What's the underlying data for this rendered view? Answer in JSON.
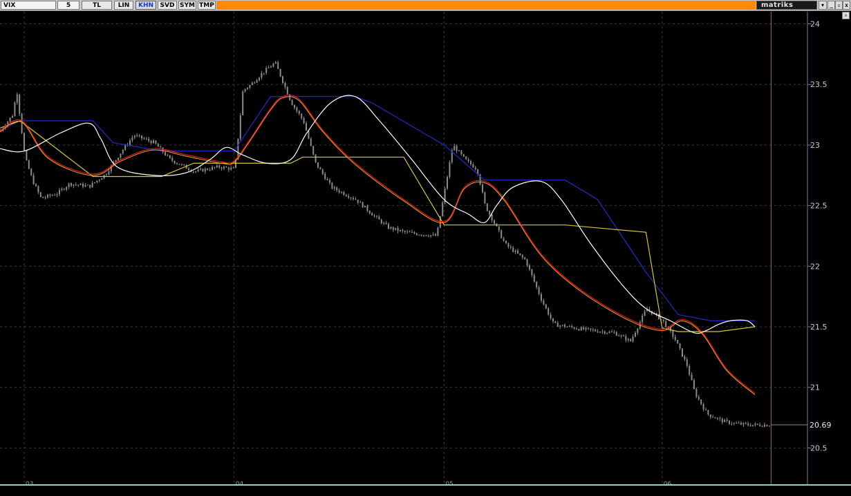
{
  "toolbar": {
    "symbol": "VIX",
    "period": "5",
    "buttons": [
      {
        "id": "tl",
        "label": "TL"
      },
      {
        "id": "lin",
        "label": "LIN"
      },
      {
        "id": "khn",
        "label": "KHN",
        "active": true
      },
      {
        "id": "svd",
        "label": "SVD"
      },
      {
        "id": "sym",
        "label": "SYM"
      },
      {
        "id": "tmp",
        "label": "TMP"
      }
    ],
    "brand": "matriks",
    "dropdown_glyph": "▾",
    "window_controls": [
      "_",
      "▫",
      "x"
    ],
    "accent_color": "#ff8a00"
  },
  "chart_data": {
    "type": "candlestick",
    "symbol": "VIX",
    "interval": "5",
    "ylim": [
      20.2,
      24.1
    ],
    "yticks": [
      24,
      23.5,
      23,
      22.5,
      22,
      21.5,
      21,
      20.5
    ],
    "last_value": 20.69,
    "x_day_labels": [
      "03",
      "04",
      "05",
      "06"
    ],
    "x_day_positions": [
      0.03,
      0.29,
      0.55,
      0.82
    ],
    "cursor_position": 0.955,
    "colors": {
      "candles": "#8c8c8c",
      "blue_line": "#1e2ccc",
      "red_line": "#e01e1e",
      "yellow_line": "#d8c830",
      "white_line": "#ffffff",
      "cursor": "#a040a0",
      "grid": "#3a3a3a",
      "axis": "#7a7aa0"
    },
    "series": [
      {
        "kind": "step",
        "color": "blue",
        "points": [
          [
            0.0,
            23.12
          ],
          [
            0.025,
            23.2
          ],
          [
            0.115,
            23.2
          ],
          [
            0.14,
            23.02
          ],
          [
            0.2,
            22.95
          ],
          [
            0.25,
            22.95
          ],
          [
            0.28,
            22.95
          ],
          [
            0.29,
            22.95
          ],
          [
            0.335,
            23.4
          ],
          [
            0.44,
            23.4
          ],
          [
            0.46,
            23.35
          ],
          [
            0.55,
            23.0
          ],
          [
            0.6,
            22.71
          ],
          [
            0.7,
            22.71
          ],
          [
            0.74,
            22.55
          ],
          [
            0.8,
            21.95
          ],
          [
            0.84,
            21.6
          ],
          [
            0.88,
            21.55
          ],
          [
            0.935,
            21.55
          ]
        ]
      },
      {
        "kind": "step",
        "color": "yellow",
        "points": [
          [
            0.0,
            23.14
          ],
          [
            0.025,
            23.2
          ],
          [
            0.115,
            22.74
          ],
          [
            0.2,
            22.74
          ],
          [
            0.24,
            22.85
          ],
          [
            0.29,
            22.85
          ],
          [
            0.335,
            22.85
          ],
          [
            0.36,
            22.85
          ],
          [
            0.375,
            22.9
          ],
          [
            0.4,
            22.9
          ],
          [
            0.44,
            22.9
          ],
          [
            0.5,
            22.9
          ],
          [
            0.55,
            22.34
          ],
          [
            0.64,
            22.34
          ],
          [
            0.7,
            22.34
          ],
          [
            0.8,
            22.28
          ],
          [
            0.82,
            21.49
          ],
          [
            0.84,
            21.46
          ],
          [
            0.89,
            21.46
          ],
          [
            0.935,
            21.5
          ]
        ]
      },
      {
        "kind": "smooth",
        "color": "red",
        "points": [
          [
            0.0,
            23.12
          ],
          [
            0.027,
            23.2
          ],
          [
            0.06,
            22.9
          ],
          [
            0.115,
            22.76
          ],
          [
            0.15,
            22.88
          ],
          [
            0.19,
            22.97
          ],
          [
            0.23,
            22.92
          ],
          [
            0.275,
            22.86
          ],
          [
            0.29,
            22.87
          ],
          [
            0.31,
            23.05
          ],
          [
            0.335,
            23.3
          ],
          [
            0.35,
            23.4
          ],
          [
            0.37,
            23.38
          ],
          [
            0.4,
            23.12
          ],
          [
            0.44,
            22.85
          ],
          [
            0.5,
            22.55
          ],
          [
            0.55,
            22.37
          ],
          [
            0.575,
            22.65
          ],
          [
            0.6,
            22.7
          ],
          [
            0.625,
            22.55
          ],
          [
            0.67,
            22.1
          ],
          [
            0.72,
            21.8
          ],
          [
            0.78,
            21.56
          ],
          [
            0.82,
            21.48
          ],
          [
            0.845,
            21.56
          ],
          [
            0.87,
            21.45
          ],
          [
            0.9,
            21.15
          ],
          [
            0.935,
            20.95
          ]
        ]
      },
      {
        "kind": "smooth",
        "color": "white",
        "points": [
          [
            0.0,
            22.97
          ],
          [
            0.03,
            22.95
          ],
          [
            0.075,
            23.1
          ],
          [
            0.11,
            23.18
          ],
          [
            0.125,
            23.05
          ],
          [
            0.145,
            22.82
          ],
          [
            0.19,
            22.75
          ],
          [
            0.23,
            22.77
          ],
          [
            0.26,
            22.88
          ],
          [
            0.28,
            22.98
          ],
          [
            0.3,
            22.92
          ],
          [
            0.33,
            22.85
          ],
          [
            0.36,
            22.88
          ],
          [
            0.38,
            23.1
          ],
          [
            0.41,
            23.35
          ],
          [
            0.44,
            23.4
          ],
          [
            0.47,
            23.2
          ],
          [
            0.51,
            22.88
          ],
          [
            0.55,
            22.55
          ],
          [
            0.58,
            22.43
          ],
          [
            0.6,
            22.36
          ],
          [
            0.615,
            22.5
          ],
          [
            0.635,
            22.65
          ],
          [
            0.67,
            22.7
          ],
          [
            0.695,
            22.55
          ],
          [
            0.73,
            22.2
          ],
          [
            0.77,
            21.85
          ],
          [
            0.8,
            21.65
          ],
          [
            0.83,
            21.55
          ],
          [
            0.86,
            21.45
          ],
          [
            0.875,
            21.47
          ],
          [
            0.89,
            21.52
          ],
          [
            0.905,
            21.55
          ],
          [
            0.925,
            21.55
          ],
          [
            0.935,
            21.5
          ]
        ]
      }
    ],
    "candle_path": [
      [
        0.0,
        23.12
      ],
      [
        0.015,
        23.25
      ],
      [
        0.02,
        23.45
      ],
      [
        0.03,
        22.9
      ],
      [
        0.04,
        22.7
      ],
      [
        0.05,
        22.56
      ],
      [
        0.07,
        22.6
      ],
      [
        0.085,
        22.68
      ],
      [
        0.11,
        22.66
      ],
      [
        0.13,
        22.76
      ],
      [
        0.15,
        22.95
      ],
      [
        0.165,
        23.08
      ],
      [
        0.19,
        23.02
      ],
      [
        0.21,
        22.88
      ],
      [
        0.24,
        22.78
      ],
      [
        0.27,
        22.82
      ],
      [
        0.29,
        22.8
      ],
      [
        0.3,
        23.45
      ],
      [
        0.31,
        23.5
      ],
      [
        0.325,
        23.6
      ],
      [
        0.34,
        23.68
      ],
      [
        0.36,
        23.35
      ],
      [
        0.375,
        23.2
      ],
      [
        0.39,
        22.85
      ],
      [
        0.41,
        22.65
      ],
      [
        0.44,
        22.55
      ],
      [
        0.465,
        22.4
      ],
      [
        0.48,
        22.32
      ],
      [
        0.5,
        22.28
      ],
      [
        0.54,
        22.25
      ],
      [
        0.56,
        23.0
      ],
      [
        0.575,
        22.88
      ],
      [
        0.59,
        22.8
      ],
      [
        0.6,
        22.5
      ],
      [
        0.625,
        22.18
      ],
      [
        0.65,
        22.05
      ],
      [
        0.67,
        21.72
      ],
      [
        0.685,
        21.52
      ],
      [
        0.72,
        21.48
      ],
      [
        0.76,
        21.45
      ],
      [
        0.78,
        21.38
      ],
      [
        0.8,
        21.65
      ],
      [
        0.82,
        21.55
      ],
      [
        0.835,
        21.4
      ],
      [
        0.85,
        21.18
      ],
      [
        0.86,
        20.95
      ],
      [
        0.875,
        20.78
      ],
      [
        0.895,
        20.72
      ],
      [
        0.91,
        20.7
      ],
      [
        0.93,
        20.69
      ]
    ]
  }
}
